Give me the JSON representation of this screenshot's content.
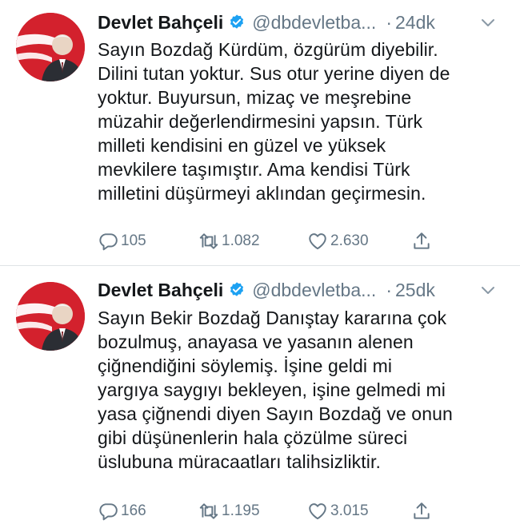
{
  "colors": {
    "text": "#14171a",
    "secondary": "#657786",
    "verified": "#1da1f2",
    "avatar_bg": "#d3212d",
    "divider": "#dfe3e6"
  },
  "icons": {
    "verified": "verified-badge-icon",
    "menu": "chevron-down-icon",
    "reply": "reply-icon",
    "retweet": "retweet-icon",
    "like": "heart-icon",
    "share": "share-icon"
  },
  "tweets": [
    {
      "name": "Devlet Bahçeli",
      "handle": "@dbdevletba...",
      "separator": "·",
      "time": "24dk",
      "lines": [
        "Sayın Bozdağ Kürdüm, özgürüm diyebilir.",
        "Dilini tutan yoktur. Sus otur yerine diyen de",
        "yoktur. Buyursun, mizaç ve meşrebine",
        "müzahir değerlendirmesini yapsın. Türk",
        "milleti kendisini en güzel ve yüksek",
        "mevkilere taşımıştır. Ama kendisi Türk",
        "milletini düşürmeyi aklından geçirmesin."
      ],
      "replies": "105",
      "retweets": "1.082",
      "likes": "2.630"
    },
    {
      "name": "Devlet Bahçeli",
      "handle": "@dbdevletba...",
      "separator": "·",
      "time": "25dk",
      "lines": [
        "Sayın Bekir Bozdağ Danıştay kararına çok",
        "bozulmuş, anayasa ve yasanın alenen",
        "çiğnendiğini söylemiş. İşine geldi mi",
        "yargıya saygıyı bekleyen, işine gelmedi mi",
        "yasa çiğnendi diyen Sayın Bozdağ ve onun",
        "gibi düşünenlerin hala çözülme süreci",
        "üslubuna müracaatları talihsizliktir."
      ],
      "replies": "166",
      "retweets": "1.195",
      "likes": "3.015"
    }
  ]
}
